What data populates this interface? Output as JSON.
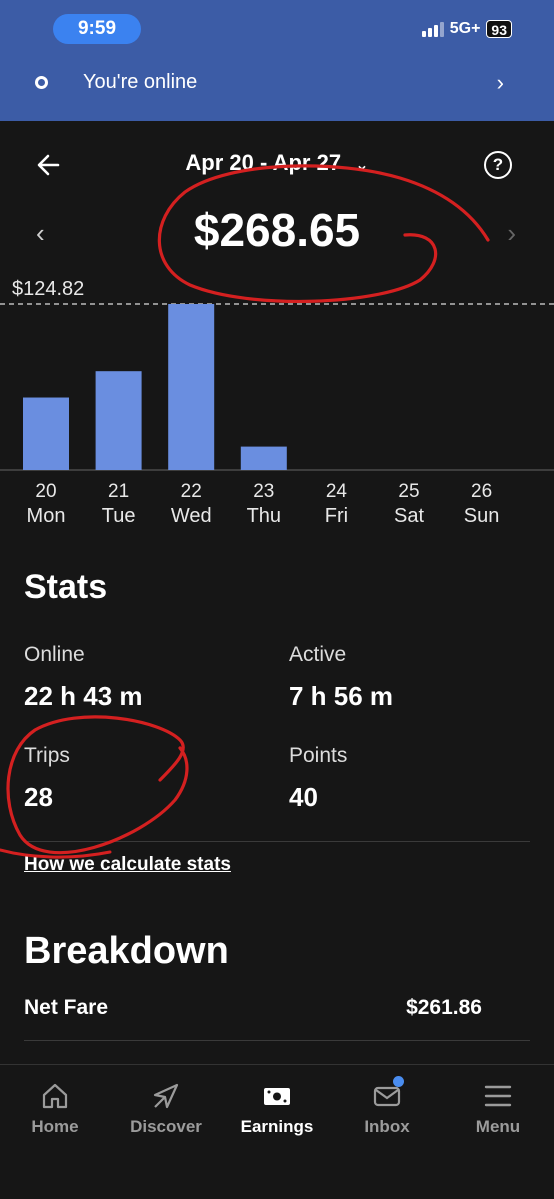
{
  "status_bar": {
    "time": "9:59",
    "network": "5G+",
    "battery": "93"
  },
  "banner": {
    "text": "You're online"
  },
  "header": {
    "date_range": "Apr 20 - Apr 27",
    "total": "$268.65"
  },
  "chart_data": {
    "type": "bar",
    "categories": [
      "20 Mon",
      "21 Tue",
      "22 Wed",
      "23 Thu",
      "24 Fri",
      "25 Sat",
      "26 Sun"
    ],
    "day_numbers": [
      "20",
      "21",
      "22",
      "23",
      "24",
      "25",
      "26"
    ],
    "day_names": [
      "Mon",
      "Tue",
      "Wed",
      "Thu",
      "Fri",
      "Sat",
      "Sun"
    ],
    "values": [
      54.5,
      74.3,
      124.82,
      17.6,
      0,
      0,
      0
    ],
    "max_label": "$124.82",
    "ylim": [
      0,
      124.82
    ],
    "bar_color": "#6a8ee0"
  },
  "stats": {
    "title": "Stats",
    "online_label": "Online",
    "online_value": "22 h 43 m",
    "active_label": "Active",
    "active_value": "7 h 56 m",
    "trips_label": "Trips",
    "trips_value": "28",
    "points_label": "Points",
    "points_value": "40",
    "link": "How we calculate stats"
  },
  "breakdown": {
    "title": "Breakdown",
    "rows": [
      {
        "label": "Net Fare",
        "value": "$261.86"
      }
    ]
  },
  "nav": {
    "items": [
      {
        "label": "Home",
        "icon": "home-icon"
      },
      {
        "label": "Discover",
        "icon": "compass-icon"
      },
      {
        "label": "Earnings",
        "icon": "earnings-icon"
      },
      {
        "label": "Inbox",
        "icon": "mail-icon"
      },
      {
        "label": "Menu",
        "icon": "menu-icon"
      }
    ]
  },
  "colors": {
    "banner": "#3c5ca6",
    "accent": "#3b82f0",
    "annotation": "#d42020",
    "background": "#161616"
  }
}
